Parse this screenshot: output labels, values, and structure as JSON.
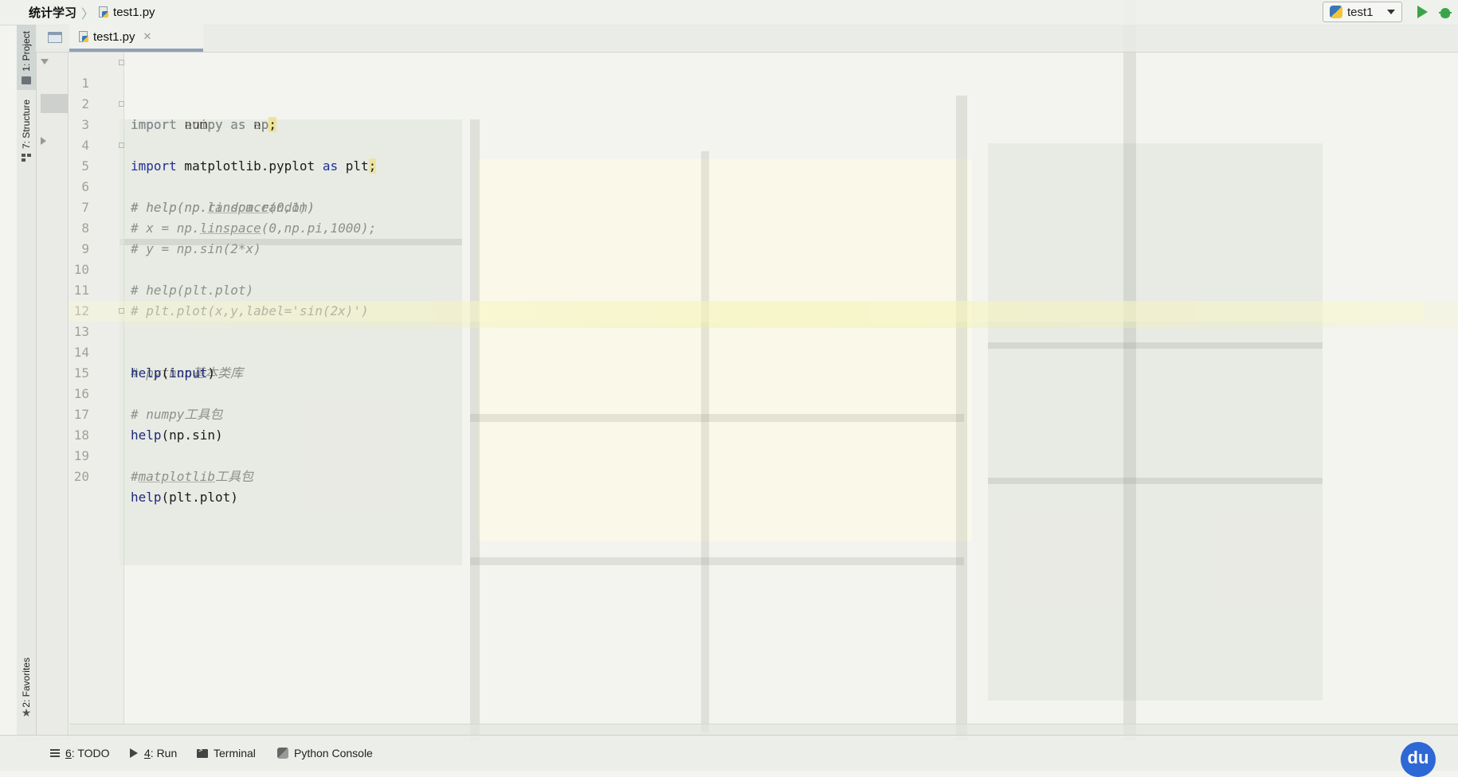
{
  "navbar": {
    "project": "统计学习",
    "file": "test1.py",
    "run_config": "test1"
  },
  "tool_stripe": {
    "project_tab": "1: Project",
    "structure_tab": "7: Structure",
    "favorites_tab": "2: Favorites"
  },
  "editor": {
    "tab_label": "test1.py",
    "lines": [
      {
        "num": "1"
      },
      {
        "num": "2"
      },
      {
        "num": "3"
      },
      {
        "num": "4"
      },
      {
        "num": "5"
      },
      {
        "num": "6"
      },
      {
        "num": "7"
      },
      {
        "num": "8"
      },
      {
        "num": "9"
      },
      {
        "num": "10"
      },
      {
        "num": "11"
      },
      {
        "num": "12"
      },
      {
        "num": "13"
      },
      {
        "num": "14"
      },
      {
        "num": "15"
      },
      {
        "num": "16"
      },
      {
        "num": "17"
      },
      {
        "num": "18"
      },
      {
        "num": "19"
      },
      {
        "num": "20"
      }
    ],
    "code": {
      "l1_kw1": "import",
      "l1_mod": " numpy ",
      "l1_kw2": "as",
      "l1_alias": " np",
      "l1_semi": ";",
      "l2": "import scipy as sp",
      "l2_semi": ";",
      "l3_kw1": "import",
      "l3_mod": " matplotlib.pyplot ",
      "l3_kw2": "as",
      "l3_alias": " plt",
      "l3_semi": ";",
      "l5": "# help(np.random.random)",
      "l6_a": "# help(np.",
      "l6_b": "linspace",
      "l6_c": "(0,1))",
      "l7_a": "# x = np.",
      "l7_b": "linspace",
      "l7_c": "(0,np.pi,1000);",
      "l8": "# y = np.sin(2*x)",
      "l10": "# help(plt.plot)",
      "l11": "# plt.plot(x,y,label='sin(2x)')",
      "l13": "# python基本类库",
      "l14_fn": "help",
      "l14_rest": "(",
      "l14_arg": "input",
      "l14_end": ")",
      "l16": "# numpy工具包",
      "l17_fn": "help",
      "l17_rest": "(np.sin)",
      "l19_a": "#",
      "l19_b": "matplotlib",
      "l19_c": "工具包",
      "l20_fn": "help",
      "l20_rest": "(plt.plot)"
    }
  },
  "bottom_bar": {
    "todo_num": "6",
    "todo_label": ": TODO",
    "run_num": "4",
    "run_label": ": Run",
    "terminal": "Terminal",
    "python_console": "Python Console",
    "du_badge": "du"
  },
  "colors": {
    "keyword": "#1e2f9a",
    "comment": "#8d918a",
    "run_green": "#3aa44a"
  }
}
